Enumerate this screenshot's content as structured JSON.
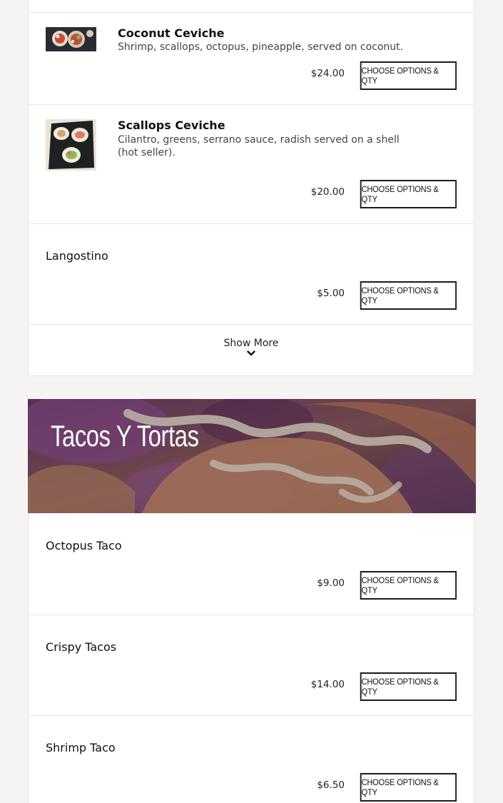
{
  "menu": {
    "section_items_top": [
      {
        "name": "Coconut Ceviche",
        "description": "Shrimp, scallops, octopus, pineapple, served on coconut.",
        "price": "$24.00",
        "button_label": "CHOOSE OPTIONS & QTY",
        "has_image": true
      },
      {
        "name": "Scallops Ceviche",
        "description": "Cilantro, greens, serrano sauce, radish served on a shell (hot seller).",
        "price": "$20.00",
        "button_label": "CHOOSE OPTIONS & QTY",
        "has_image": true
      },
      {
        "name": "Langostino",
        "price": "$5.00",
        "button_label": "CHOOSE OPTIONS & QTY",
        "has_image": false
      }
    ],
    "show_more_label": "Show More",
    "category_banner": {
      "title": "Tacos Y Tortas"
    },
    "section_items_tacos": [
      {
        "name": "Octopus Taco",
        "price": "$9.00",
        "button_label": "CHOOSE OPTIONS & QTY"
      },
      {
        "name": "Crispy Tacos",
        "price": "$14.00",
        "button_label": "CHOOSE OPTIONS & QTY"
      },
      {
        "name": "Shrimp Taco",
        "price": "$6.50",
        "button_label": "CHOOSE OPTIONS & QTY"
      }
    ]
  },
  "icons": {
    "show_more_chevron": "chevron-down-icon"
  },
  "colors": {
    "page_background": "#f5f4f2",
    "card_background": "#ffffff",
    "button_border": "#1a1a1a",
    "banner_tint": "#5a2a55"
  }
}
